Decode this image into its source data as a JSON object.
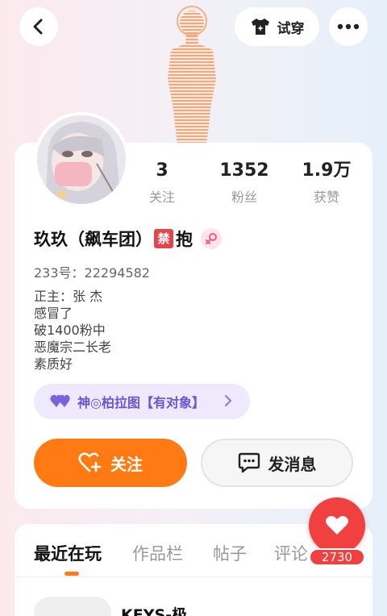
{
  "topbar": {
    "try_on_label": "试穿",
    "back_icon": "chevron-left-icon",
    "more_icon": "more-dots-icon",
    "shirt_icon": "shirt-sparkle-icon"
  },
  "profile": {
    "stats": [
      {
        "value": "3",
        "label": "关注"
      },
      {
        "value": "1352",
        "label": "粉丝"
      },
      {
        "value": "1.9万",
        "label": "获赞"
      }
    ],
    "name": "玖玖（飙车团）",
    "ban_char": "禁",
    "name_suffix": "抱",
    "gender_icon": "female-icon",
    "uid": "233号：22294582",
    "bio_lines": [
      "正主：张 杰",
      "感冒了",
      "破1400粉中",
      "恶魔宗二长老",
      "素质好"
    ],
    "relation": "神◎柏拉图【有对象】",
    "follow_label": "关注",
    "message_label": "发消息"
  },
  "tabs": [
    "最近在玩",
    "作品栏",
    "帖子",
    "评论"
  ],
  "recent": {
    "game_title": "KEYS-极"
  },
  "like": {
    "count": "2730"
  },
  "colors": {
    "accent": "#ff7a12",
    "like": "#f04040",
    "relation_text": "#6a54d8",
    "ban": "#e8424a"
  }
}
